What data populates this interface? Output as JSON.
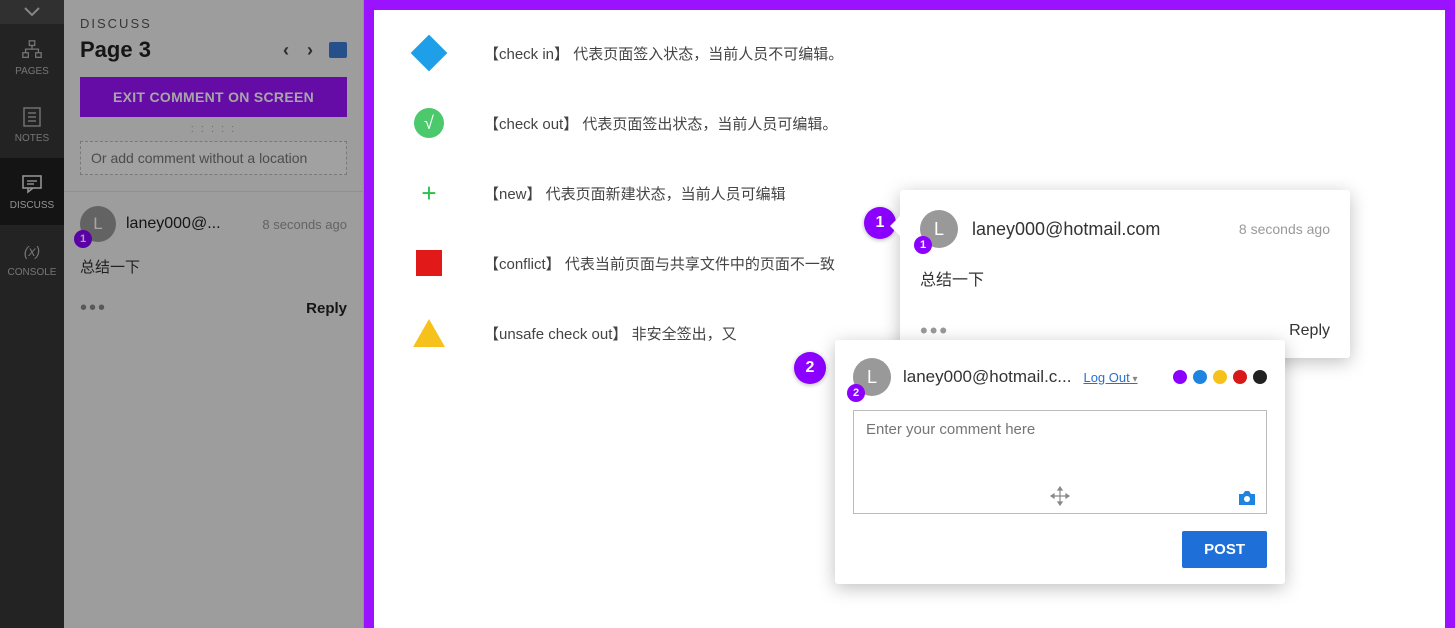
{
  "rail": {
    "items": [
      {
        "label": "PAGES"
      },
      {
        "label": "NOTES"
      },
      {
        "label": "DISCUSS"
      },
      {
        "label": "CONSOLE"
      }
    ]
  },
  "sidebar": {
    "section": "DISCUSS",
    "page_title": "Page 3",
    "exit_label": "EXIT COMMENT ON SCREEN",
    "add_placeholder": "Or add comment without a location",
    "comment": {
      "avatar_initial": "L",
      "marker": "1",
      "user": "laney000@...",
      "time": "8 seconds ago",
      "body": "总结一下",
      "reply_label": "Reply"
    }
  },
  "legend": [
    {
      "key": "diamond",
      "text": "【check in】 代表页面签入状态，当前人员不可编辑。"
    },
    {
      "key": "circle",
      "text": "【check out】 代表页面签出状态，当前人员可编辑。"
    },
    {
      "key": "plus",
      "text": "【new】 代表页面新建状态，当前人员可编辑"
    },
    {
      "key": "square",
      "text": "【conflict】 代表当前页面与共享文件中的页面不一致"
    },
    {
      "key": "triangle",
      "text": "【unsafe check out】 非安全签出，又"
    }
  ],
  "markers": {
    "m1": "1",
    "m2": "2"
  },
  "popover_view": {
    "avatar_initial": "L",
    "marker": "1",
    "user": "laney000@hotmail.com",
    "time": "8 seconds ago",
    "body": "总结一下",
    "reply_label": "Reply"
  },
  "popover_input": {
    "avatar_initial": "L",
    "marker": "2",
    "user": "laney000@hotmail.c...",
    "logout_label": "Log Out",
    "placeholder": "Enter your comment here",
    "post_label": "POST",
    "colors": [
      "#8b00ff",
      "#1e84e0",
      "#f7c11b",
      "#d81919",
      "#222222"
    ]
  }
}
